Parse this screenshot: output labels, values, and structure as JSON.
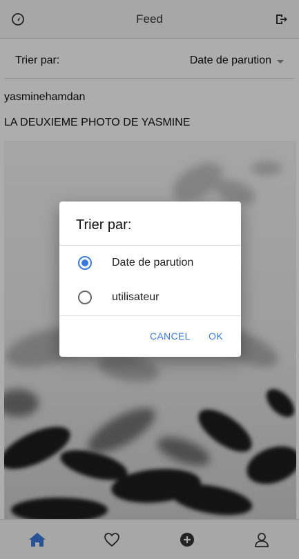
{
  "header": {
    "title": "Feed",
    "left_icon": "navigation-icon",
    "right_icon": "logout-icon"
  },
  "sort_bar": {
    "label": "Trier par:",
    "selected": "Date de parution"
  },
  "post": {
    "author": "yasminehamdan",
    "caption": "LA DEUXIEME PHOTO DE YASMINE"
  },
  "dialog": {
    "title": "Trier par:",
    "options": [
      {
        "label": "Date de parution",
        "selected": true
      },
      {
        "label": "utilisateur",
        "selected": false
      }
    ],
    "cancel_label": "CANCEL",
    "ok_label": "OK"
  },
  "tab_bar": {
    "items": [
      {
        "icon": "home-icon",
        "active": true
      },
      {
        "icon": "heart-icon",
        "active": false
      },
      {
        "icon": "add-circle-icon",
        "active": false
      },
      {
        "icon": "person-icon",
        "active": false
      }
    ]
  },
  "colors": {
    "accent": "#3a7ae0",
    "scrim": "rgba(0,0,0,0.32)"
  }
}
